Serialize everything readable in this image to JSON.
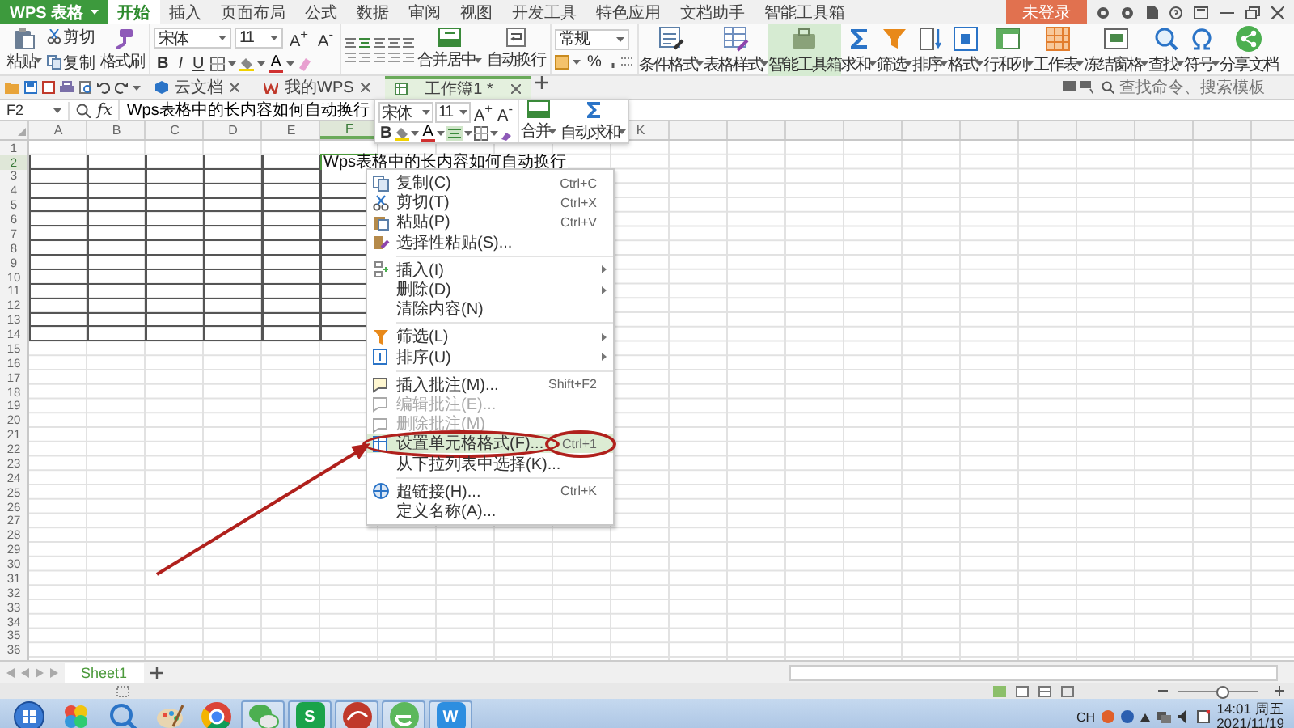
{
  "app": {
    "name": "WPS 表格",
    "login": "未登录"
  },
  "menu_tabs": [
    {
      "label": "开始",
      "selected": true
    },
    {
      "label": "插入",
      "selected": false
    },
    {
      "label": "页面布局",
      "selected": false
    },
    {
      "label": "公式",
      "selected": false
    },
    {
      "label": "数据",
      "selected": false
    },
    {
      "label": "审阅",
      "selected": false
    },
    {
      "label": "视图",
      "selected": false
    },
    {
      "label": "开发工具",
      "selected": false
    },
    {
      "label": "特色应用",
      "selected": false
    },
    {
      "label": "文档助手",
      "selected": false
    },
    {
      "label": "智能工具箱",
      "selected": false
    }
  ],
  "ribbon": {
    "paste": "粘贴",
    "cut": "剪切",
    "copy": "复制",
    "format_painter": "格式刷",
    "font": "宋体",
    "size": "11",
    "grow": "A$^{+}$",
    "shrink": "A$^{-}$",
    "styles": [
      "B",
      "I",
      "U"
    ],
    "font_color": "A",
    "merge": "合并居中",
    "wrap": "自动换行",
    "number_format": "常规",
    "percent": "%",
    "tools": [
      {
        "label": "条件格式",
        "dropdown": true,
        "selected": false
      },
      {
        "label": "表格样式",
        "dropdown": true,
        "selected": false
      },
      {
        "label": "智能工具箱",
        "dropdown": false,
        "selected": true
      },
      {
        "label": "求和",
        "dropdown": true,
        "selected": false
      },
      {
        "label": "筛选",
        "dropdown": true,
        "selected": false
      },
      {
        "label": "排序",
        "dropdown": true,
        "selected": false
      },
      {
        "label": "格式",
        "dropdown": true,
        "selected": false
      },
      {
        "label": "行和列",
        "dropdown": true,
        "selected": false
      },
      {
        "label": "工作表",
        "dropdown": true,
        "selected": false
      },
      {
        "label": "冻结窗格",
        "dropdown": true,
        "selected": false
      },
      {
        "label": "查找",
        "dropdown": true,
        "selected": false
      },
      {
        "label": "符号",
        "dropdown": true,
        "selected": false
      },
      {
        "label": "分享文档",
        "dropdown": false,
        "selected": false
      }
    ]
  },
  "doc_tabs": [
    {
      "label": "云文档",
      "selected": false
    },
    {
      "label": "我的WPS",
      "selected": false
    },
    {
      "label": "工作簿1 *",
      "selected": true
    }
  ],
  "command_search": {
    "placeholder": "查找命令、搜索模板"
  },
  "formula_bar": {
    "cell": "F2",
    "fx": "fx",
    "content": "Wps表格中的长内容如何自动换行"
  },
  "columns": [
    {
      "label": "A",
      "selected": false
    },
    {
      "label": "B",
      "selected": false
    },
    {
      "label": "C",
      "selected": false
    },
    {
      "label": "D",
      "selected": false
    },
    {
      "label": "E",
      "selected": false
    },
    {
      "label": "F",
      "selected": true
    },
    null,
    null,
    null,
    null,
    {
      "label": "K",
      "selected": false
    }
  ],
  "rows": [
    {
      "label": "1",
      "selected": false,
      "bordered": false
    },
    {
      "label": "2",
      "selected": true,
      "bordered": true,
      "cells": [
        null,
        null,
        null,
        null,
        null,
        "Wps表格中的长内容如何自动换行"
      ]
    },
    {
      "label": "3",
      "selected": false,
      "bordered": true
    },
    {
      "label": "4",
      "selected": false,
      "bordered": true
    },
    {
      "label": "5",
      "selected": false,
      "bordered": true
    },
    {
      "label": "6",
      "selected": false,
      "bordered": true
    },
    {
      "label": "7",
      "selected": false,
      "bordered": true
    },
    {
      "label": "8",
      "selected": false,
      "bordered": true
    },
    {
      "label": "9",
      "selected": false,
      "bordered": true
    },
    {
      "label": "10",
      "selected": false,
      "bordered": true
    },
    {
      "label": "11",
      "selected": false,
      "bordered": true
    },
    {
      "label": "12",
      "selected": false,
      "bordered": true
    },
    {
      "label": "13",
      "selected": false,
      "bordered": true
    },
    {
      "label": "14",
      "selected": false,
      "bordered": true
    },
    {
      "label": "15",
      "selected": false,
      "bordered": false
    },
    {
      "label": "16",
      "selected": false,
      "bordered": false
    },
    {
      "label": "17",
      "selected": false,
      "bordered": false
    },
    {
      "label": "18",
      "selected": false,
      "bordered": false
    },
    {
      "label": "19",
      "selected": false,
      "bordered": false
    },
    {
      "label": "20",
      "selected": false,
      "bordered": false
    },
    {
      "label": "21",
      "selected": false,
      "bordered": false
    },
    {
      "label": "22",
      "selected": false,
      "bordered": false
    },
    {
      "label": "23",
      "selected": false,
      "bordered": false
    },
    {
      "label": "24",
      "selected": false,
      "bordered": false
    },
    {
      "label": "25",
      "selected": false,
      "bordered": false
    },
    {
      "label": "26",
      "selected": false,
      "bordered": false
    },
    {
      "label": "27",
      "selected": false,
      "bordered": false
    },
    {
      "label": "28",
      "selected": false,
      "bordered": false
    },
    {
      "label": "29",
      "selected": false,
      "bordered": false
    },
    {
      "label": "30",
      "selected": false,
      "bordered": false
    },
    {
      "label": "31",
      "selected": false,
      "bordered": false
    },
    {
      "label": "32",
      "selected": false,
      "bordered": false
    },
    {
      "label": "33",
      "selected": false,
      "bordered": false
    },
    {
      "label": "34",
      "selected": false,
      "bordered": false
    },
    {
      "label": "35",
      "selected": false,
      "bordered": false
    },
    {
      "label": "36",
      "selected": false,
      "bordered": false
    }
  ],
  "mini_toolbar": {
    "font": "宋体",
    "size": "11",
    "grow": "A$^{+}$",
    "shrink": "A$^{-}$",
    "bold": "B",
    "font_color": "A",
    "merge": "合并",
    "autosum": "自动求和"
  },
  "context_menu": [
    {
      "kind": "item",
      "label": "复制(C)",
      "shortcut": "Ctrl+C",
      "disabled": false,
      "selected": false,
      "submenu": false,
      "circled": false
    },
    {
      "kind": "item",
      "label": "剪切(T)",
      "shortcut": "Ctrl+X",
      "disabled": false,
      "selected": false,
      "submenu": false,
      "circled": false
    },
    {
      "kind": "item",
      "label": "粘贴(P)",
      "shortcut": "Ctrl+V",
      "disabled": false,
      "selected": false,
      "submenu": false,
      "circled": false
    },
    {
      "kind": "item",
      "label": "选择性粘贴(S)...",
      "disabled": false,
      "selected": false,
      "submenu": false,
      "circled": false
    },
    {
      "kind": "separator"
    },
    {
      "kind": "item",
      "label": "插入(I)",
      "disabled": false,
      "selected": false,
      "submenu": true,
      "circled": false
    },
    {
      "kind": "item",
      "label": "删除(D)",
      "disabled": false,
      "selected": false,
      "submenu": true,
      "circled": false
    },
    {
      "kind": "item",
      "label": "清除内容(N)",
      "disabled": false,
      "selected": false,
      "submenu": false,
      "circled": false
    },
    {
      "kind": "separator"
    },
    {
      "kind": "item",
      "label": "筛选(L)",
      "disabled": false,
      "selected": false,
      "submenu": true,
      "circled": false
    },
    {
      "kind": "item",
      "label": "排序(U)",
      "disabled": false,
      "selected": false,
      "submenu": true,
      "circled": false
    },
    {
      "kind": "separator"
    },
    {
      "kind": "item",
      "label": "插入批注(M)...",
      "shortcut": "Shift+F2",
      "disabled": false,
      "selected": false,
      "submenu": false,
      "circled": false
    },
    {
      "kind": "item",
      "label": "编辑批注(E)...",
      "disabled": true,
      "selected": false,
      "submenu": false,
      "circled": false
    },
    {
      "kind": "item",
      "label": "删除批注(M)",
      "disabled": true,
      "selected": false,
      "submenu": false,
      "circled": false
    },
    {
      "kind": "item",
      "label": "设置单元格格式(F)...",
      "shortcut": "Ctrl+1",
      "disabled": false,
      "selected": true,
      "submenu": false,
      "circled": true
    },
    {
      "kind": "item",
      "label": "从下拉列表中选择(K)...",
      "disabled": false,
      "selected": false,
      "submenu": false,
      "circled": false
    },
    {
      "kind": "separator"
    },
    {
      "kind": "item",
      "label": "超链接(H)...",
      "shortcut": "Ctrl+K",
      "disabled": false,
      "selected": false,
      "submenu": false,
      "circled": false
    },
    {
      "kind": "item",
      "label": "定义名称(A)...",
      "disabled": false,
      "selected": false,
      "submenu": false,
      "circled": false
    }
  ],
  "sheet_tabs": [
    {
      "label": "Sheet1",
      "selected": true
    }
  ],
  "zoom": {
    "level": 0.55
  },
  "taskbar": [
    {
      "open": false
    },
    {
      "open": false
    },
    {
      "open": false
    },
    {
      "open": false
    },
    {
      "open": false
    },
    {
      "open": true
    },
    {
      "open": true,
      "label": "S"
    },
    {
      "open": true
    },
    {
      "open": true
    },
    {
      "open": true,
      "label": "W"
    }
  ],
  "tray": {
    "language": "CH",
    "time": "14:01 周五",
    "date": "2021/11/19"
  }
}
